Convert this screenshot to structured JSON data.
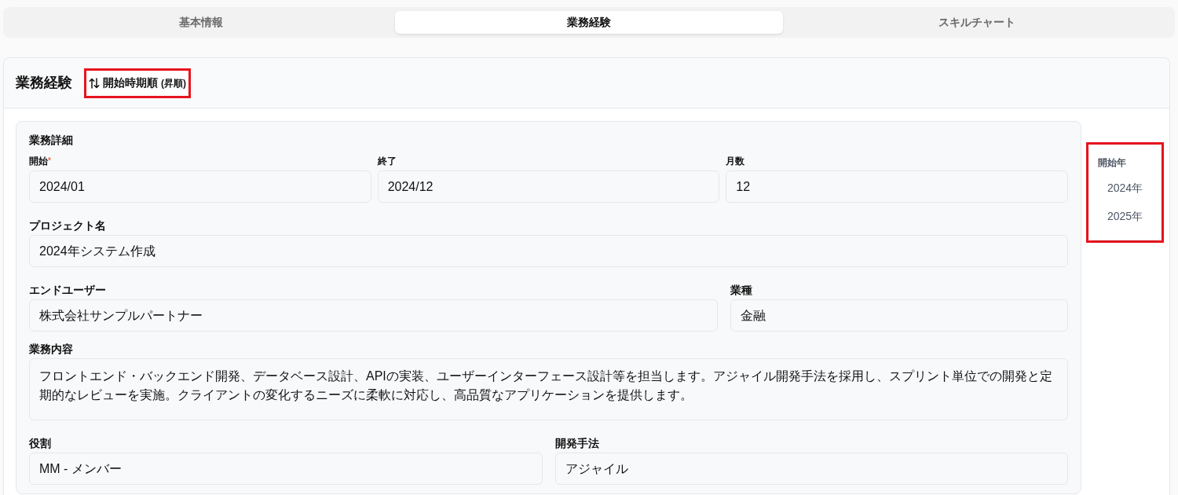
{
  "tabs": [
    {
      "label": "基本情報",
      "selected": false
    },
    {
      "label": "業務経験",
      "selected": true
    },
    {
      "label": "スキルチャート",
      "selected": false
    }
  ],
  "section": {
    "title": "業務経験",
    "sort_button": {
      "label": "開始時期順",
      "order": "(昇順)",
      "highlighted": true
    }
  },
  "detail_card": {
    "title": "業務詳細",
    "rows": [
      {
        "kind": "thirds",
        "fields": [
          {
            "label": "開始",
            "required_mark": "*",
            "value": "2024/01"
          },
          {
            "label": "終了",
            "value": "2024/12"
          },
          {
            "label": "月数",
            "value": "12"
          }
        ]
      },
      {
        "kind": "full",
        "fields": [
          {
            "label": "プロジェクト名",
            "value": "2024年システム作成"
          }
        ]
      },
      {
        "kind": "two-one",
        "fields": [
          {
            "label": "エンドユーザー",
            "value": "株式会社サンプルパートナー"
          },
          {
            "label": "業種",
            "value": "金融"
          }
        ]
      },
      {
        "kind": "multiline",
        "fields": [
          {
            "label": "業務内容",
            "value": "フロントエンド・バックエンド開発、データベース設計、APIの実装、ユーザーインターフェース設計等を担当します。アジャイル開発手法を採用し、スプリント単位での開発と定期的なレビューを実施。クライアントの変化するニーズに柔軟に対応し、高品質なアプリケーションを提供します。"
          }
        ]
      },
      {
        "kind": "halves",
        "fields": [
          {
            "label": "役割",
            "value": "MM - メンバー"
          },
          {
            "label": "開発手法",
            "value": "アジャイル"
          }
        ]
      }
    ]
  },
  "year_nav": {
    "title": "開始年",
    "highlighted": true,
    "items": [
      "2024年",
      "2025年"
    ]
  }
}
